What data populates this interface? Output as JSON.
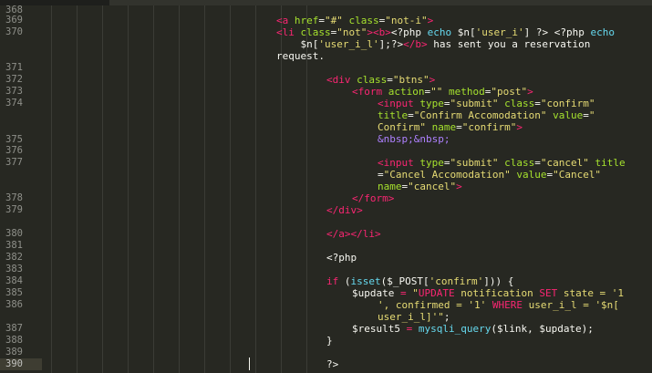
{
  "editor": {
    "line_numbers": [
      "368",
      "369",
      "370",
      "371",
      "372",
      "373",
      "374",
      "375",
      "376",
      "377",
      "378",
      "379",
      "380",
      "381",
      "382",
      "383",
      "384",
      "385",
      "386",
      "387",
      "388",
      "389",
      "390"
    ],
    "code": [
      {
        "ln": "369",
        "segments": [
          {
            "t": "<a ",
            "c": "tag"
          },
          {
            "t": "href",
            "c": "attr"
          },
          {
            "t": "=",
            "c": "txt"
          },
          {
            "t": "\"#\"",
            "c": "str"
          },
          {
            "t": " class",
            "c": "attr"
          },
          {
            "t": "=",
            "c": "txt"
          },
          {
            "t": "\"not-i\"",
            "c": "str"
          },
          {
            "t": ">",
            "c": "tag"
          }
        ]
      },
      {
        "ln": "370a",
        "segments": [
          {
            "t": "<li ",
            "c": "tag"
          },
          {
            "t": "class",
            "c": "attr"
          },
          {
            "t": "=",
            "c": "txt"
          },
          {
            "t": "\"not\"",
            "c": "str"
          },
          {
            "t": "><b>",
            "c": "tag"
          },
          {
            "t": "<?php ",
            "c": "txt"
          },
          {
            "t": "echo",
            "c": "fn"
          },
          {
            "t": " $n[",
            "c": "txt"
          },
          {
            "t": "'user_i'",
            "c": "str"
          },
          {
            "t": "] ?> <?php ",
            "c": "txt"
          },
          {
            "t": "echo",
            "c": "fn"
          }
        ]
      },
      {
        "ln": "370b",
        "segments": [
          {
            "t": "    $n[",
            "c": "txt"
          },
          {
            "t": "'user_i_l'",
            "c": "str"
          },
          {
            "t": "];?>",
            "c": "txt"
          },
          {
            "t": "</b>",
            "c": "tag"
          },
          {
            "t": " has sent you a reservation",
            "c": "txt"
          }
        ]
      },
      {
        "ln": "370c",
        "segments": [
          {
            "t": "request.",
            "c": "txt"
          }
        ]
      },
      {
        "ln": "372",
        "segments": [
          {
            "t": "<div ",
            "c": "tag"
          },
          {
            "t": "class",
            "c": "attr"
          },
          {
            "t": "=",
            "c": "txt"
          },
          {
            "t": "\"btns\"",
            "c": "str"
          },
          {
            "t": ">",
            "c": "tag"
          }
        ]
      },
      {
        "ln": "373",
        "segments": [
          {
            "t": "<form ",
            "c": "tag"
          },
          {
            "t": "action",
            "c": "attr"
          },
          {
            "t": "=",
            "c": "txt"
          },
          {
            "t": "\"\"",
            "c": "str"
          },
          {
            "t": " method",
            "c": "attr"
          },
          {
            "t": "=",
            "c": "txt"
          },
          {
            "t": "\"post\"",
            "c": "str"
          },
          {
            "t": ">",
            "c": "tag"
          }
        ]
      },
      {
        "ln": "374a",
        "segments": [
          {
            "t": "<input ",
            "c": "tag"
          },
          {
            "t": "type",
            "c": "attr"
          },
          {
            "t": "=",
            "c": "txt"
          },
          {
            "t": "\"submit\"",
            "c": "str"
          },
          {
            "t": " class",
            "c": "attr"
          },
          {
            "t": "=",
            "c": "txt"
          },
          {
            "t": "\"confirm\"",
            "c": "str"
          }
        ]
      },
      {
        "ln": "374b",
        "segments": [
          {
            "t": "title",
            "c": "attr"
          },
          {
            "t": "=",
            "c": "txt"
          },
          {
            "t": "\"Confirm Accomodation\"",
            "c": "str"
          },
          {
            "t": " value",
            "c": "attr"
          },
          {
            "t": "=",
            "c": "txt"
          },
          {
            "t": "\"",
            "c": "str"
          }
        ]
      },
      {
        "ln": "374c",
        "segments": [
          {
            "t": "Confirm\"",
            "c": "str"
          },
          {
            "t": " name",
            "c": "attr"
          },
          {
            "t": "=",
            "c": "txt"
          },
          {
            "t": "\"confirm\"",
            "c": "str"
          },
          {
            "t": ">",
            "c": "tag"
          }
        ]
      },
      {
        "ln": "375",
        "segments": [
          {
            "t": "&nbsp;&nbsp;",
            "c": "ent"
          }
        ]
      },
      {
        "ln": "377a",
        "segments": [
          {
            "t": "<input ",
            "c": "tag"
          },
          {
            "t": "type",
            "c": "attr"
          },
          {
            "t": "=",
            "c": "txt"
          },
          {
            "t": "\"submit\"",
            "c": "str"
          },
          {
            "t": " class",
            "c": "attr"
          },
          {
            "t": "=",
            "c": "txt"
          },
          {
            "t": "\"cancel\"",
            "c": "str"
          },
          {
            "t": " title",
            "c": "attr"
          }
        ]
      },
      {
        "ln": "377b",
        "segments": [
          {
            "t": "=",
            "c": "txt"
          },
          {
            "t": "\"Cancel Accomodation\"",
            "c": "str"
          },
          {
            "t": " value",
            "c": "attr"
          },
          {
            "t": "=",
            "c": "txt"
          },
          {
            "t": "\"Cancel\"",
            "c": "str"
          }
        ]
      },
      {
        "ln": "377c",
        "segments": [
          {
            "t": "name",
            "c": "attr"
          },
          {
            "t": "=",
            "c": "txt"
          },
          {
            "t": "\"cancel\"",
            "c": "str"
          },
          {
            "t": ">",
            "c": "tag"
          }
        ]
      },
      {
        "ln": "378",
        "segments": [
          {
            "t": "</form>",
            "c": "tag"
          }
        ]
      },
      {
        "ln": "379",
        "segments": [
          {
            "t": "</div>",
            "c": "tag"
          }
        ]
      },
      {
        "ln": "381",
        "segments": [
          {
            "t": "</a></li>",
            "c": "tag"
          }
        ]
      },
      {
        "ln": "383",
        "segments": [
          {
            "t": "<?php",
            "c": "txt"
          }
        ]
      },
      {
        "ln": "385",
        "segments": [
          {
            "t": "if",
            "c": "kw"
          },
          {
            "t": " (",
            "c": "txt"
          },
          {
            "t": "isset",
            "c": "fn"
          },
          {
            "t": "($_POST[",
            "c": "txt"
          },
          {
            "t": "'confirm'",
            "c": "str"
          },
          {
            "t": "])) {",
            "c": "txt"
          }
        ]
      },
      {
        "ln": "386a",
        "segments": [
          {
            "t": "$update ",
            "c": "txt"
          },
          {
            "t": "=",
            "c": "kw"
          },
          {
            "t": " \"",
            "c": "str"
          },
          {
            "t": "UPDATE",
            "c": "kw"
          },
          {
            "t": " notification ",
            "c": "str"
          },
          {
            "t": "SET",
            "c": "kw"
          },
          {
            "t": " state = '1",
            "c": "str"
          }
        ]
      },
      {
        "ln": "386b",
        "segments": [
          {
            "t": "', confirmed = '1' ",
            "c": "str"
          },
          {
            "t": "WHERE",
            "c": "kw"
          },
          {
            "t": " user_i_l = '$n[",
            "c": "str"
          }
        ]
      },
      {
        "ln": "386c",
        "segments": [
          {
            "t": "user_i_l]'\"",
            "c": "str"
          },
          {
            "t": ";",
            "c": "txt"
          }
        ]
      },
      {
        "ln": "387",
        "segments": [
          {
            "t": "$result5 ",
            "c": "txt"
          },
          {
            "t": "=",
            "c": "kw"
          },
          {
            "t": " ",
            "c": "txt"
          },
          {
            "t": "mysqli_query",
            "c": "fn"
          },
          {
            "t": "($link, $update);",
            "c": "txt"
          }
        ]
      },
      {
        "ln": "388",
        "segments": [
          {
            "t": "}",
            "c": "txt"
          }
        ]
      },
      {
        "ln": "390",
        "segments": [
          {
            "t": "?>",
            "c": "txt"
          }
        ]
      }
    ]
  },
  "colors": {
    "background": "#272822",
    "tag": "#f92672",
    "attribute": "#a6e22e",
    "string": "#e6db74",
    "function": "#66d9ef",
    "entity": "#ae81ff"
  }
}
